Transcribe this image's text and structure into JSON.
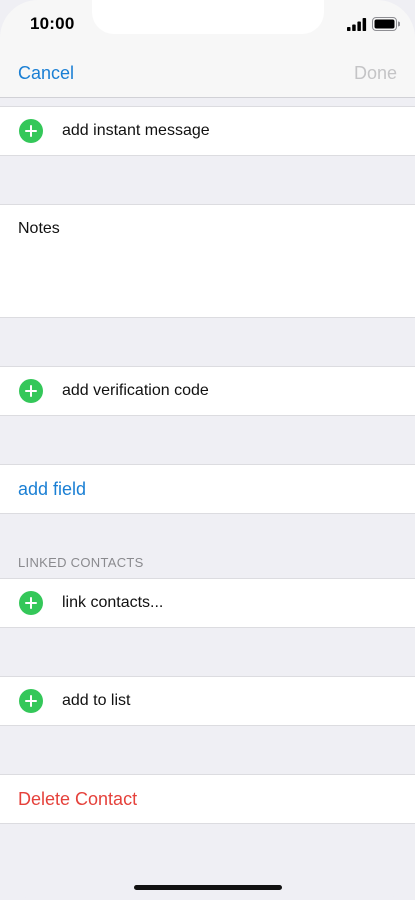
{
  "status_bar": {
    "time": "10:00"
  },
  "nav": {
    "cancel_label": "Cancel",
    "done_label": "Done"
  },
  "rows": {
    "add_instant_message": "add instant message",
    "notes_label": "Notes",
    "add_verification_code": "add verification code",
    "add_field": "add field",
    "linked_contacts_header": "LINKED CONTACTS",
    "link_contacts": "link contacts...",
    "add_to_list": "add to list",
    "delete_contact": "Delete Contact"
  },
  "colors": {
    "accent": "#1a7fd4",
    "add_green": "#34c759",
    "destructive": "#e5413b",
    "disabled": "#c4c4c6",
    "group_background": "#efeff4"
  },
  "icons": [
    "cellular-signal-icon",
    "battery-icon",
    "add-circle-icon"
  ]
}
